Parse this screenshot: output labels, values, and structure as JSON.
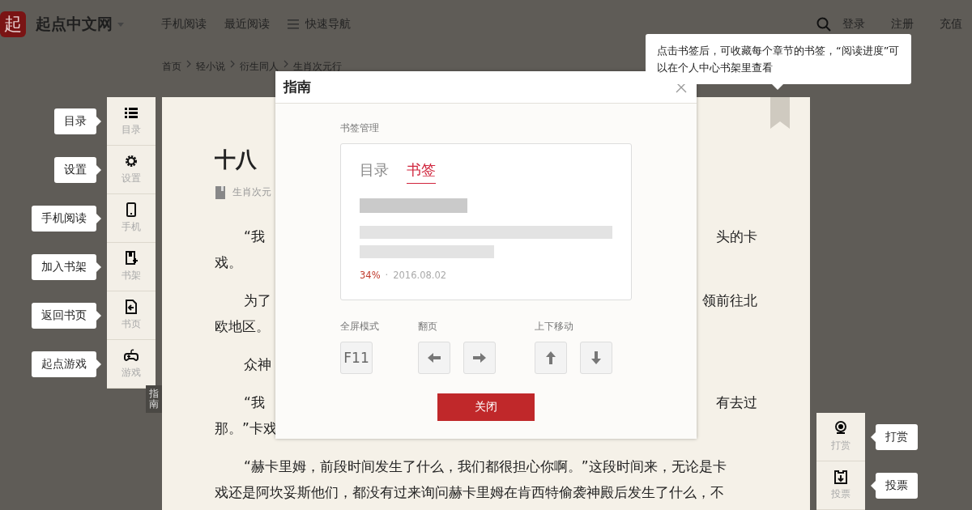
{
  "header": {
    "logo_char": "起",
    "site_name": "起点中文网",
    "nav": [
      "手机阅读",
      "最近阅读"
    ],
    "menu_item": "快速导航",
    "user_links": [
      "登录",
      "注册",
      "充值"
    ]
  },
  "breadcrumb": [
    "首页",
    "轻小说",
    "衍生同人",
    "生肖次元行"
  ],
  "side_tools": [
    {
      "kind": "list",
      "label": "目录",
      "callout": "目录"
    },
    {
      "kind": "gear",
      "label": "设置",
      "callout": "设置"
    },
    {
      "kind": "phone",
      "label": "手机",
      "callout": "手机阅读"
    },
    {
      "kind": "shelf",
      "label": "书架",
      "callout": "加入书架"
    },
    {
      "kind": "back",
      "label": "书页",
      "callout": "返回书页"
    },
    {
      "kind": "gamepad",
      "label": "游戏",
      "callout": "起点游戏"
    }
  ],
  "guide_tab": "指南",
  "chapter": {
    "title": "十八",
    "meta": "生肖次元",
    "paragraphs": [
      {
        "lines": [
          {
            "left": "“我",
            "right": "头的卡"
          },
          {
            "left": "戏。"
          }
        ]
      },
      {
        "lines": [
          {
            "left": "为了",
            "right": "领前往北"
          },
          {
            "left": "欧地区。"
          }
        ]
      },
      {
        "lines": [
          {
            "left": "众神"
          }
        ]
      },
      {
        "lines": [
          {
            "left": "“我",
            "right": "有去过"
          },
          {
            "left": "那。”卡戏"
          }
        ]
      },
      {
        "lines": [
          {
            "left": "“赫卡里姆，前段时间发生了什么，我们都很担心你啊。”这段时间来，无论是卡"
          },
          {
            "left": "戏还是阿坎妥斯他们，都没有过来询问赫卡里姆在肯西特偷袭神殿后发生了什么，不"
          }
        ]
      }
    ]
  },
  "bookmark_tip": "点击书签后，可收藏每个章节的书签，“阅读进度”可以在个人中心书架里查看",
  "dialog": {
    "title": "指南",
    "section": "书签管理",
    "tabs": [
      {
        "label": "目录",
        "selected": false
      },
      {
        "label": "书签",
        "selected": true
      }
    ],
    "progress": "34%",
    "separator": "·",
    "date": "2016.08.02",
    "key_groups": [
      {
        "label": "全屏模式",
        "keys": [
          {
            "kind": "text",
            "text": "F11"
          }
        ]
      },
      {
        "label": "翻页",
        "keys": [
          {
            "kind": "left"
          },
          {
            "kind": "right"
          }
        ]
      },
      {
        "label": "上下移动",
        "keys": [
          {
            "kind": "up"
          },
          {
            "kind": "down"
          }
        ]
      }
    ],
    "close_button": "关闭"
  },
  "right_tools": [
    {
      "kind": "coin",
      "label": "打赏",
      "callout": "打赏"
    },
    {
      "kind": "ticket",
      "label": "投票",
      "callout": "投票"
    }
  ]
}
